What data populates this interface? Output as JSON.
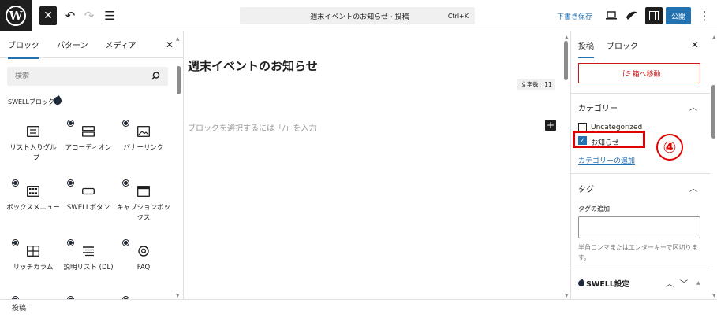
{
  "topbar": {
    "logo": "W",
    "command_title": "週末イベントのお知らせ · 投稿",
    "command_shortcut": "Ctrl+K",
    "save_draft": "下書き保存",
    "publish": "公開"
  },
  "left_panel": {
    "tabs": [
      "ブロック",
      "パターン",
      "メディア"
    ],
    "search_placeholder": "検索",
    "category_label": "SWELLブロック",
    "blocks": [
      {
        "label": "リスト入りグループ",
        "icon": "list-group-icon"
      },
      {
        "label": "アコーディオン",
        "icon": "accordion-icon"
      },
      {
        "label": "バナーリンク",
        "icon": "banner-image-icon"
      },
      {
        "label": "ボックスメニュー",
        "icon": "box-menu-grid-icon"
      },
      {
        "label": "SWELLボタン",
        "icon": "button-icon"
      },
      {
        "label": "キャプションボックス",
        "icon": "caption-box-icon"
      },
      {
        "label": "リッチカラム",
        "icon": "columns-icon"
      },
      {
        "label": "説明リスト (DL)",
        "icon": "description-list-icon"
      },
      {
        "label": "FAQ",
        "icon": "faq-icon"
      }
    ]
  },
  "editor": {
    "title": "週末イベントのお知らせ",
    "word_count": "文字数：11",
    "placeholder": "ブロックを選択するには「/」を入力"
  },
  "right_panel": {
    "tabs": [
      "投稿",
      "ブロック"
    ],
    "trash_button": "ゴミ箱へ移動",
    "categories": {
      "title": "カテゴリー",
      "items": [
        {
          "label": "Uncategorized",
          "checked": false
        },
        {
          "label": "お知らせ",
          "checked": true
        }
      ],
      "add_link": "カテゴリーの追加"
    },
    "tags": {
      "title": "タグ",
      "add_label": "タグの追加",
      "help": "半角コンマまたはエンターキーで区切ります。"
    },
    "swell_settings": "SWELL設定"
  },
  "annotation": {
    "step": "④",
    "color": "#e00000"
  },
  "bottom_bar": {
    "breadcrumb": "投稿"
  },
  "colors": {
    "accent": "#2271b1",
    "danger": "#cc1818",
    "dark": "#1e1e1e"
  }
}
